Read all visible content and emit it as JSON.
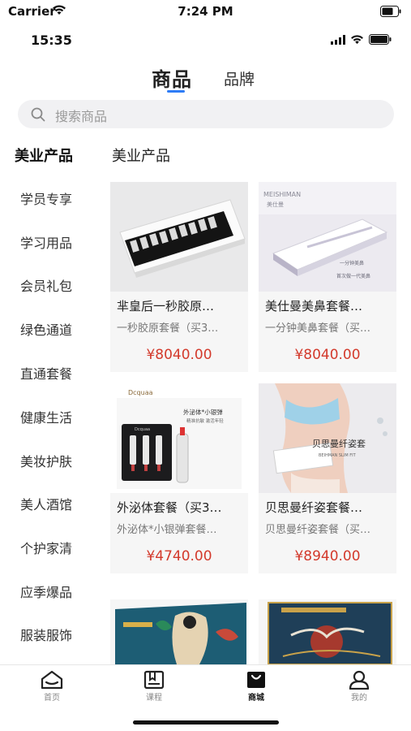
{
  "sim_status": {
    "carrier": "Carrier",
    "time": "7:24 PM"
  },
  "app_status": {
    "time": "15:35"
  },
  "top_tabs": [
    {
      "label": "商品",
      "active": true
    },
    {
      "label": "品牌",
      "active": false
    }
  ],
  "search": {
    "placeholder": "搜索商品"
  },
  "sidebar": {
    "items": [
      {
        "label": "美业产品",
        "active": true
      },
      {
        "label": "学员专享"
      },
      {
        "label": "学习用品"
      },
      {
        "label": "会员礼包"
      },
      {
        "label": "绿色通道"
      },
      {
        "label": "直通套餐"
      },
      {
        "label": "健康生活"
      },
      {
        "label": "美妆护肤"
      },
      {
        "label": "美人酒馆"
      },
      {
        "label": "个护家清"
      },
      {
        "label": "应季爆品"
      },
      {
        "label": "服装服饰"
      }
    ]
  },
  "section_title": "美业产品",
  "products": [
    {
      "title": "芈皇后一秒胶原…",
      "subtitle": "一秒胶原套餐（买3…",
      "price": "¥8040.00",
      "image": "ampoule-box"
    },
    {
      "title": "美仕曼美鼻套餐…",
      "subtitle": "一分钟美鼻套餐（买…",
      "price": "¥8040.00",
      "image": "nose-kit-box",
      "image_text": [
        "MEISHIMAN",
        "美仕曼",
        "一分钟美鼻",
        "首次做一代美鼻"
      ]
    },
    {
      "title": "外泌体套餐（买3…",
      "subtitle": "外泌体*小银弹套餐…",
      "price": "¥4740.00",
      "image": "serum-kit",
      "image_text": [
        "Dcquaa",
        "外泌体*小银弹",
        "精准抗敏 激活年轻",
        "Dcquaa"
      ]
    },
    {
      "title": "贝思曼纤姿套餐…",
      "subtitle": "贝思曼纤姿套餐（买…",
      "price": "¥8940.00",
      "image": "body-slim",
      "image_text": [
        "贝思曼纤姿套",
        "BEIHMAN SLIM FIT"
      ]
    }
  ],
  "partial_products": [
    {
      "image": "gift-box-painting"
    },
    {
      "image": "gift-box-crane"
    }
  ],
  "bottom_nav": [
    {
      "label": "首页",
      "icon": "home-icon",
      "active": false
    },
    {
      "label": "课程",
      "icon": "course-icon",
      "active": false
    },
    {
      "label": "商城",
      "icon": "shop-bag-icon",
      "active": true
    },
    {
      "label": "我的",
      "icon": "person-icon",
      "active": false
    }
  ],
  "colors": {
    "accent": "#2e7cf6",
    "price": "#d33a2c",
    "card_bg": "#f6f6f6"
  }
}
